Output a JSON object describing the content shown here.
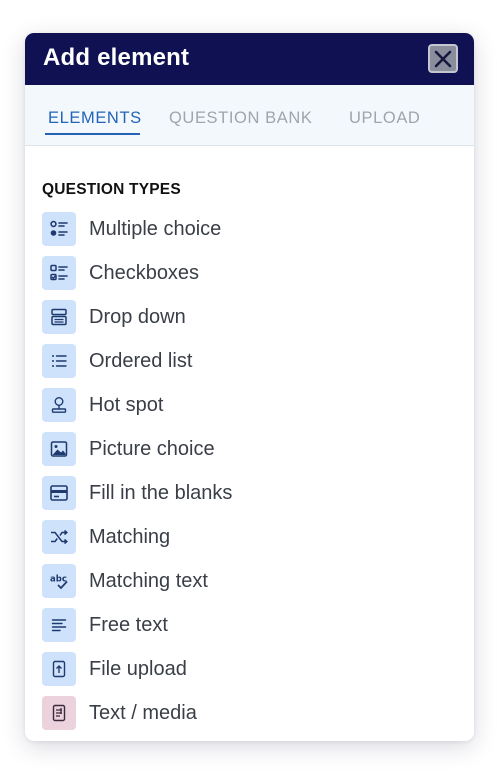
{
  "dialog": {
    "title": "Add element",
    "close_icon": "close-icon"
  },
  "tabs": [
    {
      "label": "ELEMENTS",
      "active": true
    },
    {
      "label": "QUESTION BANK",
      "active": false
    },
    {
      "label": "UPLOAD",
      "active": false
    }
  ],
  "section": {
    "title": "QUESTION TYPES"
  },
  "items": [
    {
      "label": "Multiple choice",
      "icon": "multiple-choice-icon"
    },
    {
      "label": "Checkboxes",
      "icon": "checkboxes-icon"
    },
    {
      "label": "Drop down",
      "icon": "dropdown-icon"
    },
    {
      "label": "Ordered list",
      "icon": "ordered-list-icon"
    },
    {
      "label": "Hot spot",
      "icon": "hot-spot-icon"
    },
    {
      "label": "Picture choice",
      "icon": "picture-icon"
    },
    {
      "label": "Fill in the blanks",
      "icon": "fill-blanks-icon"
    },
    {
      "label": "Matching",
      "icon": "shuffle-icon"
    },
    {
      "label": "Matching text",
      "icon": "abc-check-icon"
    },
    {
      "label": "Free text",
      "icon": "text-lines-icon"
    },
    {
      "label": "File upload",
      "icon": "file-upload-icon"
    },
    {
      "label": "Text / media",
      "icon": "text-media-icon"
    }
  ],
  "colors": {
    "header_bg": "#0f1152",
    "accent": "#2463b8",
    "icon_bg": "#cfe2fb",
    "icon_bg_media": "#ecd2dc",
    "icon_fg": "#1f3a6e"
  }
}
